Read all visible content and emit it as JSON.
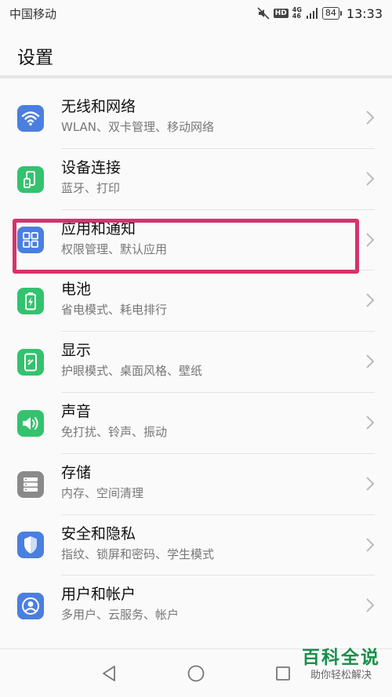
{
  "status": {
    "carrier": "中国移动",
    "hd": "HD",
    "net_top": "4G",
    "net_bottom": "46",
    "battery": "84",
    "time": "13:33"
  },
  "header": {
    "title": "设置"
  },
  "items": [
    {
      "title": "无线和网络",
      "subtitle": "WLAN、双卡管理、移动网络",
      "icon": "wifi-icon",
      "color": "#4a7fe0"
    },
    {
      "title": "设备连接",
      "subtitle": "蓝牙、打印",
      "icon": "device-connect-icon",
      "color": "#34c26e"
    },
    {
      "title": "应用和通知",
      "subtitle": "权限管理、默认应用",
      "icon": "apps-icon",
      "color": "#4a7fe0"
    },
    {
      "title": "电池",
      "subtitle": "省电模式、耗电排行",
      "icon": "battery-icon",
      "color": "#34c26e"
    },
    {
      "title": "显示",
      "subtitle": "护眼模式、桌面风格、壁纸",
      "icon": "display-icon",
      "color": "#34c26e"
    },
    {
      "title": "声音",
      "subtitle": "免打扰、铃声、振动",
      "icon": "sound-icon",
      "color": "#34c26e"
    },
    {
      "title": "存储",
      "subtitle": "内存、空间清理",
      "icon": "storage-icon",
      "color": "#8a8a8a"
    },
    {
      "title": "安全和隐私",
      "subtitle": "指纹、锁屏和密码、学生模式",
      "icon": "shield-icon",
      "color": "#4a7fe0"
    },
    {
      "title": "用户和帐户",
      "subtitle": "多用户、云服务、帐户",
      "icon": "user-icon",
      "color": "#4a7fe0"
    }
  ],
  "watermark": {
    "title": "百科全说",
    "subtitle": "助你轻松解决"
  },
  "highlight_color": "#d6336c"
}
